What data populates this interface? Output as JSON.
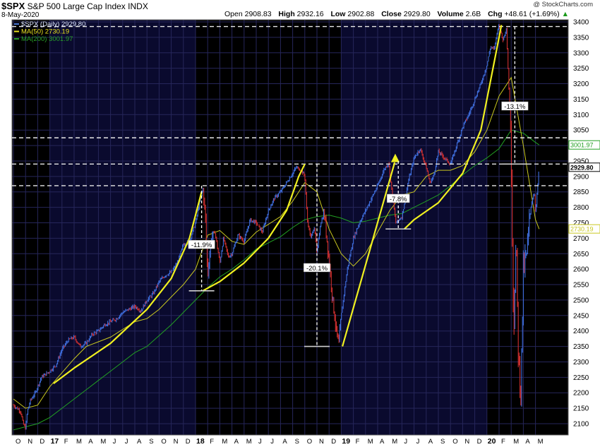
{
  "header": {
    "symbol": "$SPX",
    "name": "S&P 500 Large Cap Index",
    "exchange": "INDX",
    "date": "8-May-2020",
    "open_label": "Open",
    "open": "2908.83",
    "high_label": "High",
    "high": "2932.16",
    "low_label": "Low",
    "low": "2902.88",
    "close_label": "Close",
    "close": "2929.80",
    "volume_label": "Volume",
    "volume": "2.6B",
    "chg_label": "Chg",
    "chg": "+48.61 (+1.69%)",
    "watermark": "@ StockCharts.com"
  },
  "legend": [
    {
      "text": "$SPX (Daily) 2929.80",
      "color": "#4a78d8"
    },
    {
      "text": "MA(50) 2730.19",
      "color": "#e8e020"
    },
    {
      "text": "MA(200) 3001.97",
      "color": "#28a028"
    }
  ],
  "colors": {
    "panel_bg": "#000000",
    "shade_bg": "#0a0a2e",
    "grid": "#26265a",
    "up": "#3f6fe0",
    "down": "#d23030",
    "ma50": "#c9c820",
    "ma200": "#22a022",
    "trend": "#f0f020"
  },
  "chart_data": {
    "type": "line",
    "title": "$SPX S&P 500 Large Cap Index",
    "ylim": [
      2075,
      3410
    ],
    "y_ticks": [
      2100,
      2150,
      2200,
      2250,
      2300,
      2350,
      2400,
      2450,
      2500,
      2550,
      2600,
      2650,
      2700,
      2750,
      2800,
      2850,
      2900,
      2950,
      3000,
      3050,
      3100,
      3150,
      3200,
      3250,
      3300,
      3350,
      3400
    ],
    "x_axis_labels": [
      {
        "label": "O",
        "t": 0,
        "type": "month"
      },
      {
        "label": "N",
        "t": 1,
        "type": "month"
      },
      {
        "label": "D",
        "t": 2,
        "type": "month"
      },
      {
        "label": "17",
        "t": 3,
        "type": "year"
      },
      {
        "label": "F",
        "t": 4,
        "type": "month"
      },
      {
        "label": "M",
        "t": 5,
        "type": "month"
      },
      {
        "label": "A",
        "t": 6,
        "type": "month"
      },
      {
        "label": "M",
        "t": 7,
        "type": "month"
      },
      {
        "label": "J",
        "t": 8,
        "type": "month"
      },
      {
        "label": "J",
        "t": 9,
        "type": "month"
      },
      {
        "label": "A",
        "t": 10,
        "type": "month"
      },
      {
        "label": "S",
        "t": 11,
        "type": "month"
      },
      {
        "label": "O",
        "t": 12,
        "type": "month"
      },
      {
        "label": "N",
        "t": 13,
        "type": "month"
      },
      {
        "label": "D",
        "t": 14,
        "type": "month"
      },
      {
        "label": "18",
        "t": 15,
        "type": "year"
      },
      {
        "label": "F",
        "t": 16,
        "type": "month"
      },
      {
        "label": "M",
        "t": 17,
        "type": "month"
      },
      {
        "label": "A",
        "t": 18,
        "type": "month"
      },
      {
        "label": "M",
        "t": 19,
        "type": "month"
      },
      {
        "label": "J",
        "t": 20,
        "type": "month"
      },
      {
        "label": "J",
        "t": 21,
        "type": "month"
      },
      {
        "label": "A",
        "t": 22,
        "type": "month"
      },
      {
        "label": "S",
        "t": 23,
        "type": "month"
      },
      {
        "label": "O",
        "t": 24,
        "type": "month"
      },
      {
        "label": "N",
        "t": 25,
        "type": "month"
      },
      {
        "label": "D",
        "t": 26,
        "type": "month"
      },
      {
        "label": "19",
        "t": 27,
        "type": "year"
      },
      {
        "label": "F",
        "t": 28,
        "type": "month"
      },
      {
        "label": "M",
        "t": 29,
        "type": "month"
      },
      {
        "label": "A",
        "t": 30,
        "type": "month"
      },
      {
        "label": "M",
        "t": 31,
        "type": "month"
      },
      {
        "label": "J",
        "t": 32,
        "type": "month"
      },
      {
        "label": "J",
        "t": 33,
        "type": "month"
      },
      {
        "label": "A",
        "t": 34,
        "type": "month"
      },
      {
        "label": "S",
        "t": 35,
        "type": "month"
      },
      {
        "label": "O",
        "t": 36,
        "type": "month"
      },
      {
        "label": "N",
        "t": 37,
        "type": "month"
      },
      {
        "label": "D",
        "t": 38,
        "type": "month"
      },
      {
        "label": "20",
        "t": 39,
        "type": "year"
      },
      {
        "label": "F",
        "t": 40,
        "type": "month"
      },
      {
        "label": "M",
        "t": 41,
        "type": "month"
      },
      {
        "label": "A",
        "t": 42,
        "type": "month"
      },
      {
        "label": "M",
        "t": 43,
        "type": "month"
      }
    ],
    "series": [
      {
        "name": "$SPX (Daily) 2929.80",
        "kind": "price",
        "t": [
          0,
          0.3,
          0.6,
          0.8,
          1,
          1.15,
          1.4,
          1.8,
          2.3,
          3,
          3.5,
          4,
          4.5,
          5,
          5.5,
          6,
          6.5,
          7,
          7.5,
          8,
          8.5,
          9,
          9.5,
          10,
          10.5,
          11,
          11.5,
          12,
          12.5,
          13,
          13.5,
          14,
          14.5,
          15,
          15.3,
          15.6,
          15.8,
          16,
          16.3,
          16.6,
          17,
          17.3,
          17.7,
          18,
          18.5,
          19,
          19.5,
          20,
          20.5,
          21,
          21.5,
          22,
          22.5,
          23,
          23.3,
          23.7,
          24,
          24.2,
          24.5,
          24.8,
          25,
          25.3,
          25.6,
          26,
          26.3,
          26.6,
          26.8,
          27,
          27.5,
          28,
          28.5,
          29,
          29.5,
          30,
          30.5,
          30.9,
          31.2,
          31.5,
          32,
          32.5,
          33,
          33.5,
          34,
          34.3,
          34.6,
          35,
          35.5,
          36,
          36.5,
          37,
          37.5,
          38,
          38.5,
          39,
          39.3,
          39.6,
          39.9,
          40,
          40.3,
          40.6,
          40.9,
          41,
          41.2,
          41.4,
          41.6,
          41.8,
          42,
          42.3,
          42.6,
          42.9,
          43,
          43.3
        ],
        "values": [
          2160,
          2150,
          2140,
          2100,
          2085,
          2140,
          2175,
          2200,
          2250,
          2270,
          2290,
          2340,
          2370,
          2380,
          2350,
          2360,
          2390,
          2400,
          2420,
          2430,
          2440,
          2460,
          2470,
          2480,
          2465,
          2500,
          2520,
          2560,
          2580,
          2590,
          2620,
          2680,
          2690,
          2750,
          2810,
          2860,
          2780,
          2580,
          2700,
          2720,
          2620,
          2700,
          2640,
          2650,
          2710,
          2690,
          2760,
          2750,
          2720,
          2790,
          2830,
          2850,
          2880,
          2910,
          2930,
          2920,
          2900,
          2760,
          2700,
          2740,
          2650,
          2750,
          2780,
          2630,
          2500,
          2400,
          2350,
          2450,
          2600,
          2700,
          2750,
          2790,
          2830,
          2870,
          2920,
          2945,
          2840,
          2750,
          2770,
          2880,
          2960,
          2990,
          2930,
          2880,
          2900,
          2980,
          2960,
          2940,
          3000,
          3060,
          3100,
          3150,
          3200,
          3260,
          3320,
          3310,
          3380,
          3390,
          3340,
          3380,
          3100,
          2980,
          2400,
          2700,
          2300,
          2200,
          2600,
          2650,
          2800,
          2850,
          2780,
          2930,
          2830,
          2930
        ]
      },
      {
        "name": "MA(50) 2730.19",
        "kind": "ma50",
        "t": [
          0,
          1,
          2,
          3,
          4,
          5,
          6,
          7,
          8,
          9,
          10,
          11,
          12,
          13,
          14,
          15,
          16,
          17,
          18,
          19,
          20,
          21,
          22,
          23,
          24,
          25,
          26,
          27,
          28,
          29,
          30,
          31,
          32,
          33,
          34,
          35,
          36,
          37,
          38,
          39,
          40,
          41,
          42,
          43,
          43.3
        ],
        "values": [
          2180,
          2150,
          2160,
          2220,
          2265,
          2310,
          2350,
          2365,
          2380,
          2405,
          2430,
          2440,
          2470,
          2510,
          2550,
          2600,
          2710,
          2725,
          2690,
          2680,
          2720,
          2745,
          2770,
          2820,
          2880,
          2850,
          2730,
          2650,
          2610,
          2650,
          2720,
          2790,
          2840,
          2850,
          2900,
          2920,
          2920,
          2935,
          2980,
          3050,
          3160,
          3220,
          3000,
          2760,
          2730
        ]
      },
      {
        "name": "MA(200) 3001.97",
        "kind": "ma200",
        "t": [
          0,
          1,
          2,
          3,
          4,
          5,
          6,
          7,
          8,
          9,
          10,
          11,
          12,
          13,
          14,
          15,
          16,
          17,
          18,
          19,
          20,
          21,
          22,
          23,
          24,
          25,
          26,
          27,
          28,
          29,
          30,
          31,
          32,
          33,
          34,
          35,
          36,
          37,
          38,
          39,
          40,
          41,
          42,
          43,
          43.3
        ],
        "values": [
          2080,
          2090,
          2100,
          2120,
          2150,
          2180,
          2210,
          2240,
          2270,
          2300,
          2330,
          2350,
          2385,
          2420,
          2460,
          2500,
          2540,
          2575,
          2600,
          2630,
          2665,
          2685,
          2705,
          2735,
          2760,
          2770,
          2775,
          2765,
          2750,
          2755,
          2765,
          2775,
          2780,
          2800,
          2820,
          2840,
          2870,
          2905,
          2935,
          2960,
          2990,
          3050,
          3040,
          3010,
          3002
        ]
      }
    ],
    "trend_lines": [
      {
        "t": [
          3.3,
          5,
          8,
          11,
          13,
          14.5,
          15.5
        ],
        "values": [
          2230,
          2280,
          2360,
          2470,
          2570,
          2700,
          2850
        ]
      },
      {
        "t": [
          15.6,
          17,
          19,
          21,
          22.5,
          23.5,
          24
        ],
        "values": [
          2530,
          2560,
          2620,
          2700,
          2790,
          2900,
          2940
        ]
      },
      {
        "t": [
          27.1,
          31.4
        ],
        "values": [
          2350,
          2945
        ]
      },
      {
        "t": [
          32.2,
          33,
          35,
          37,
          38.5,
          39.5,
          40.2
        ],
        "values": [
          2730,
          2760,
          2815,
          2910,
          3050,
          3250,
          3390
        ]
      }
    ],
    "arrows": [
      {
        "t": 31.45,
        "value": 2960
      }
    ],
    "horizontal_lines": [
      3025,
      2940,
      2870,
      3385
    ],
    "drawdowns": [
      {
        "label": "-11.9%",
        "t": 15.5,
        "top": 2870,
        "bottom": 2530,
        "label_value": 2680
      },
      {
        "label": "-20.1%",
        "t": 25,
        "top": 2940,
        "bottom": 2350,
        "label_value": 2605
      },
      {
        "label": "-7.8%",
        "t": 31.7,
        "top": 2950,
        "bottom": 2730,
        "label_value": 2829
      },
      {
        "label": "-13.1%",
        "t": 41.3,
        "top": 3385,
        "bottom": 2940,
        "label_value": 3128
      }
    ],
    "price_tags": [
      {
        "label": "3001.97",
        "value": 3001.97,
        "color": "#22a022"
      },
      {
        "label": "2929.80",
        "value": 2929.8,
        "color": "#000000"
      },
      {
        "label": "2730.19",
        "value": 2730.19,
        "color": "#c9c820"
      }
    ],
    "shaded_years": [
      [
        3,
        15
      ],
      [
        27,
        39
      ]
    ]
  }
}
